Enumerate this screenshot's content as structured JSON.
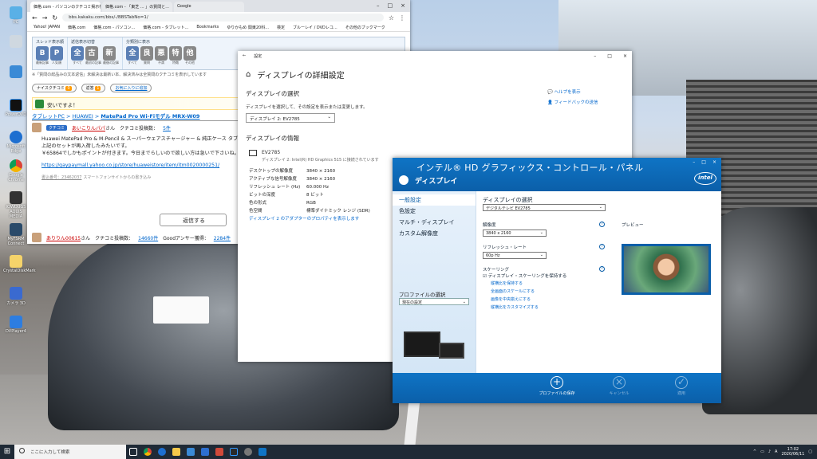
{
  "desktop": {
    "icons": [
      {
        "label": "PC"
      },
      {
        "label": ""
      },
      {
        "label": ""
      },
      {
        "label": "PowerDVD"
      },
      {
        "label": "Microsoft Edge"
      },
      {
        "label": "Google Chrome"
      },
      {
        "label": "IOWDUGS AQUIS MEDIA"
      },
      {
        "label": "MyFSRM Connect"
      },
      {
        "label": "CrystalDiskMark"
      },
      {
        "label": "カメラ 3D"
      },
      {
        "label": "DVPlayer4"
      }
    ]
  },
  "browser": {
    "tabs": [
      {
        "label": "価格.com - パソコンのクチコミ掲示板"
      },
      {
        "label": "価格.com - 「東芝 ... 」の質問と..."
      },
      {
        "label": "Google"
      }
    ],
    "url": "bbs.kakaku.com/bbs/-/BBSTabNo=1/",
    "bookmarks": [
      "Yahoo! JAPAN",
      "価格.com",
      "価格.com - パソコン...",
      "価格.com - タブレット...",
      "Bookmarks",
      "ゆりかもめ 関東20科...",
      "検定",
      "ブルーレイ / DVDレコ...",
      "その他のブックマーク"
    ],
    "thread_groups": [
      {
        "label": "スレッド表示順",
        "buttons": [
          {
            "glyph": "B",
            "sub": "最新記事"
          },
          {
            "glyph": "P",
            "sub": "人気順"
          }
        ]
      },
      {
        "label": "返信表示切替",
        "buttons": [
          {
            "glyph": "全",
            "sub": "すべて"
          },
          {
            "glyph": "古",
            "sub": "最初の記事"
          },
          {
            "glyph": "新",
            "sub": "最後の記事"
          }
        ]
      },
      {
        "label": "分類別に表示",
        "buttons": [
          {
            "glyph": "全",
            "sub": "すべて"
          },
          {
            "glyph": "良",
            "sub": "質問"
          },
          {
            "glyph": "悪",
            "sub": "不満"
          },
          {
            "glyph": "特",
            "sub": "特徴"
          },
          {
            "glyph": "他",
            "sub": "その他"
          }
        ]
      }
    ],
    "note": "※「質問の総品みの文本返信」未解決は最新い本、解決済みは全質問のクチコミを表示しています",
    "toolrow": {
      "nice_label": "ナイスクチコミ",
      "nice_count": "0",
      "thanks_label": "返答",
      "thanks_count": "1",
      "favorite": "お気に入りに追加"
    },
    "nice_banner": "安いですよ！",
    "breadcrumb": [
      "タブレットPC",
      "HUAWEI",
      "MatePad Pro Wi-Fiモデル MRX-W09"
    ],
    "poster": {
      "tag": "クチコミ",
      "name": "あいこりんパパ",
      "suffix": "さん",
      "count_label": "クチコミ投稿数：",
      "count": "5件"
    },
    "body_lines": [
      "Huawei MatePad Pro & M-Pencil & スーパーウェアスチャージャー & 純正ケース タブレット",
      "上記のセットが再入荷したみたいです。",
      "￥65864でしかもポイントが付きます。今日までらしいので欲しい方は急いで下さいね。",
      "https://gaypaymall.yahoo.co.jp/store/huaweistore/item/itm0020000251/"
    ],
    "post_meta": {
      "id": "書込番号：23462037",
      "device": "スマートフォンサイトからの書き込み"
    },
    "reply_label": "返信する",
    "reply_user": {
      "name": "ありりん00615",
      "suffix": "さん",
      "count_label": "クチコミ投稿数：",
      "count": "14660件",
      "good_label": "Goodアンサー獲得：",
      "good": "2284件"
    }
  },
  "settings": {
    "title": "設定",
    "heading": "ディスプレイの詳細設定",
    "select_section": "ディスプレイの選択",
    "select_desc": "ディスプレイを選択して、その設定を表示または変更します。",
    "select_value": "ディスプレイ 2: EV2785",
    "info_section": "ディスプレイの情報",
    "monitor_name": "EV2785",
    "monitor_sub": "ディスプレイ 2: Intel(R) HD Graphics 515 に接続されています",
    "info": [
      {
        "k": "デスクトップの解像度",
        "v": "3840 × 2160"
      },
      {
        "k": "アクティブな信号解像度",
        "v": "3840 × 2160"
      },
      {
        "k": "リフレッシュ レート (Hz)",
        "v": "60.000 Hz"
      },
      {
        "k": "ビットの深度",
        "v": "8 ビット"
      },
      {
        "k": "色の形式",
        "v": "RGB"
      },
      {
        "k": "色空間",
        "v": "標準ダイナミック レンジ (SDR)"
      }
    ],
    "adapter_link": "ディスプレイ 2 のアダプターのプロパティを表示します",
    "help": [
      "ヘルプを表示",
      "フィードバックの送信"
    ]
  },
  "intel": {
    "title": "インテル® HD グラフィックス・コントロール・パネル",
    "subtitle": "ディスプレイ",
    "logo": "intel",
    "nav": [
      "一般設定",
      "色設定",
      "マルチ・ディスプレイ",
      "カスタム解像度"
    ],
    "profile_label": "プロファイルの選択",
    "profile_value": "現在の設定",
    "display_select_label": "ディスプレイの選択",
    "display_select_value": "デジタルテレビ EV2785",
    "resolution_label": "解像度",
    "resolution_value": "3840 x 2160",
    "refresh_label": "リフレッシュ・レート",
    "refresh_value": "60p Hz",
    "scaling_label": "スケーリング",
    "scaling_checkbox": "ディスプレイ・スケーリングを保持する",
    "scaling_options": [
      "縦横比を保持する",
      "全画面のスケールにする",
      "画像を中央揃えにする",
      "縦横比をカスタマイズする"
    ],
    "preview_label": "プレビュー",
    "footer": [
      {
        "icon": "+",
        "label": "プロファイルの保存"
      },
      {
        "icon": "×",
        "label": "キャンセル"
      },
      {
        "icon": "✓",
        "label": "適用"
      }
    ]
  },
  "taskbar": {
    "search_placeholder": "ここに入力して検索",
    "time": "17:02",
    "date": "2020/06/11"
  }
}
